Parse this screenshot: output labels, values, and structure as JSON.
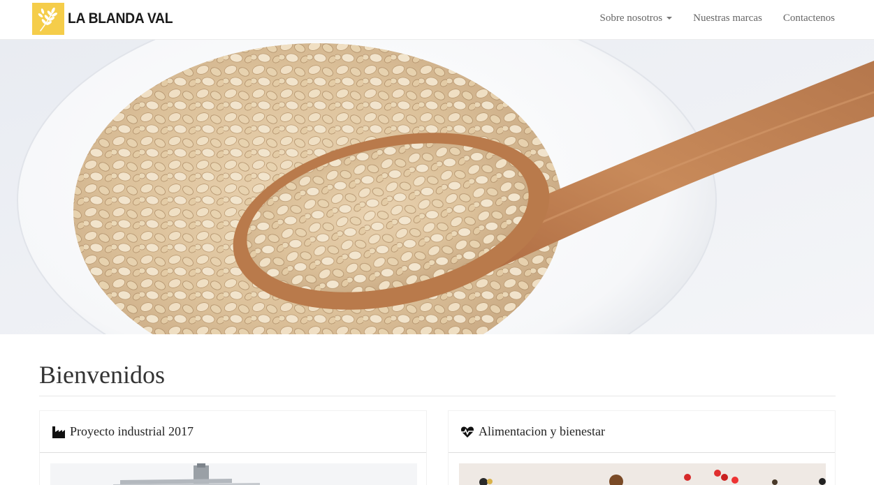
{
  "brand": {
    "name": "LA BLANDA VAL",
    "logo_icon": "wheat-icon",
    "logo_color": "#f5cd4a"
  },
  "nav": {
    "items": [
      {
        "label": "Sobre nosotros",
        "has_dropdown": true
      },
      {
        "label": "Nuestras marcas",
        "has_dropdown": false
      },
      {
        "label": "Contactenos",
        "has_dropdown": false
      }
    ]
  },
  "hero": {
    "image": "oats-in-bowl-with-wooden-spoon"
  },
  "main": {
    "heading": "Bienvenidos",
    "cards": [
      {
        "title": "Proyecto industrial 2017",
        "icon": "industry-icon",
        "image": "factory-building"
      },
      {
        "title": "Alimentacion y bienestar",
        "icon": "heartbeat-icon",
        "image": "fruits-and-nuts"
      }
    ]
  }
}
